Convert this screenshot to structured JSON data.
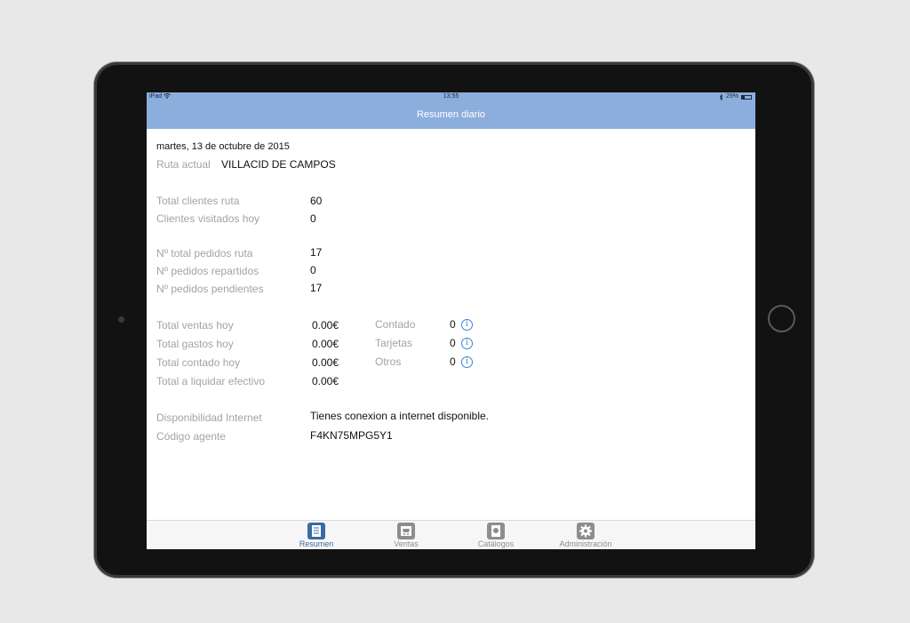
{
  "status_bar": {
    "device": "iPad",
    "time": "13:55",
    "battery": "29%",
    "battery_level": 0.29
  },
  "nav": {
    "title": "Resumen diario"
  },
  "summary": {
    "date": "martes, 13 de octubre de 2015",
    "route_label": "Ruta actual",
    "route_value": "VILLACID DE CAMPOS",
    "clients": [
      {
        "label": "Total clientes ruta",
        "value": "60"
      },
      {
        "label": "Clientes visitados hoy",
        "value": "0"
      }
    ],
    "orders": [
      {
        "label": "Nº total pedidos ruta",
        "value": "17"
      },
      {
        "label": "Nº pedidos repartidos",
        "value": "0"
      },
      {
        "label": "Nº pedidos pendientes",
        "value": "17"
      }
    ],
    "money": [
      {
        "label": "Total ventas hoy",
        "value": "0.00€"
      },
      {
        "label": "Total gastos hoy",
        "value": "0.00€"
      },
      {
        "label": "Total contado hoy",
        "value": "0.00€"
      },
      {
        "label": "Total a liquidar efectivo",
        "value": "0.00€"
      }
    ],
    "payments": [
      {
        "label": "Contado",
        "value": "0"
      },
      {
        "label": "Tarjetas",
        "value": "0"
      },
      {
        "label": "Otros",
        "value": "0"
      }
    ],
    "info_glyph": "i",
    "internet_label": "Disponibilidad Internet",
    "internet_value": "Tienes conexion a internet disponible.",
    "agent_label": "Código agente",
    "agent_value": "F4KN75MPG5Y1"
  },
  "tabs": [
    {
      "label": "Resumen",
      "icon": "document-icon",
      "active": true
    },
    {
      "label": "Ventas",
      "icon": "cart-icon",
      "active": false
    },
    {
      "label": "Catálogos",
      "icon": "catalog-icon",
      "active": false
    },
    {
      "label": "Administración",
      "icon": "gear-icon",
      "active": false
    }
  ],
  "colors": {
    "bar": "#8caedc",
    "active_tab": "#3c69a8",
    "info": "#3a85d6"
  }
}
